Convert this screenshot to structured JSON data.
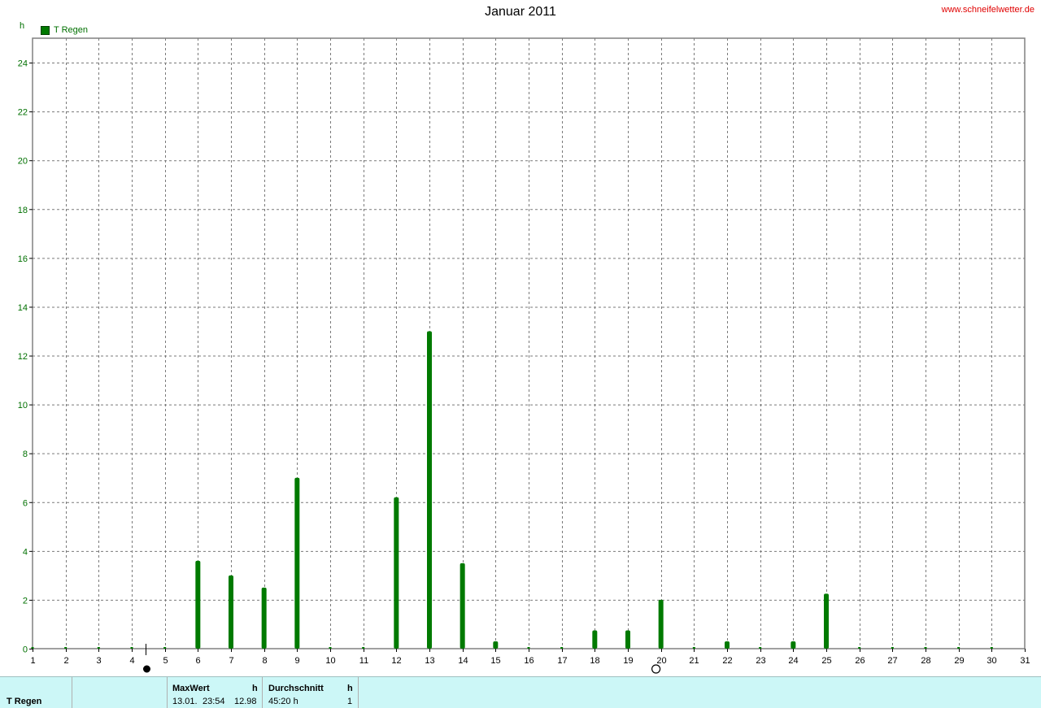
{
  "header": {
    "title": "Januar 2011",
    "site": "www.schneifelwetter.de",
    "unit": "h",
    "legend_label": "T Regen"
  },
  "colors": {
    "bar": "#007a00",
    "axis_text": "#007000",
    "grid": "#7a7a7a",
    "footer_bg": "#ccf7f7",
    "site": "#e00000"
  },
  "chart_data": {
    "type": "bar",
    "title": "Januar 2011",
    "ylabel": "h",
    "xlabel": "",
    "series": [
      {
        "name": "T Regen",
        "x": [
          1,
          2,
          3,
          4,
          5,
          6,
          7,
          8,
          9,
          10,
          11,
          12,
          13,
          14,
          15,
          16,
          17,
          18,
          19,
          20,
          21,
          22,
          23,
          24,
          25,
          26,
          27,
          28,
          29,
          30
        ],
        "values": [
          0,
          0,
          0,
          0,
          0,
          3.6,
          3.0,
          2.5,
          7.0,
          0,
          0,
          6.2,
          13.0,
          3.5,
          0.3,
          0,
          0,
          0.75,
          0.75,
          2.0,
          0,
          0.3,
          0,
          0.3,
          2.25,
          0,
          0,
          0,
          0,
          0
        ]
      }
    ],
    "x_ticks": [
      1,
      2,
      3,
      4,
      5,
      6,
      7,
      8,
      9,
      10,
      11,
      12,
      13,
      14,
      15,
      16,
      17,
      18,
      19,
      20,
      21,
      22,
      23,
      24,
      25,
      26,
      27,
      28,
      29,
      30,
      31
    ],
    "y_ticks": [
      0,
      2,
      4,
      6,
      8,
      10,
      12,
      14,
      16,
      18,
      20,
      22,
      24
    ],
    "xlim": [
      1,
      31
    ],
    "ylim": [
      0,
      25
    ],
    "grid": true,
    "legend_position": "top-left",
    "moon_phases": [
      {
        "x": 4.43,
        "phase": "new-moon"
      },
      {
        "x": 19.9,
        "phase": "full-moon"
      }
    ]
  },
  "footer": {
    "series_name": "T Regen",
    "max_label": "MaxWert",
    "max_unit": "h",
    "max_date": "13.01.",
    "max_time": "23:54",
    "max_value": "12.98",
    "avg_label": "Durchschnitt",
    "avg_unit": "h",
    "avg_value": "45:20 h",
    "avg_count": "1"
  }
}
